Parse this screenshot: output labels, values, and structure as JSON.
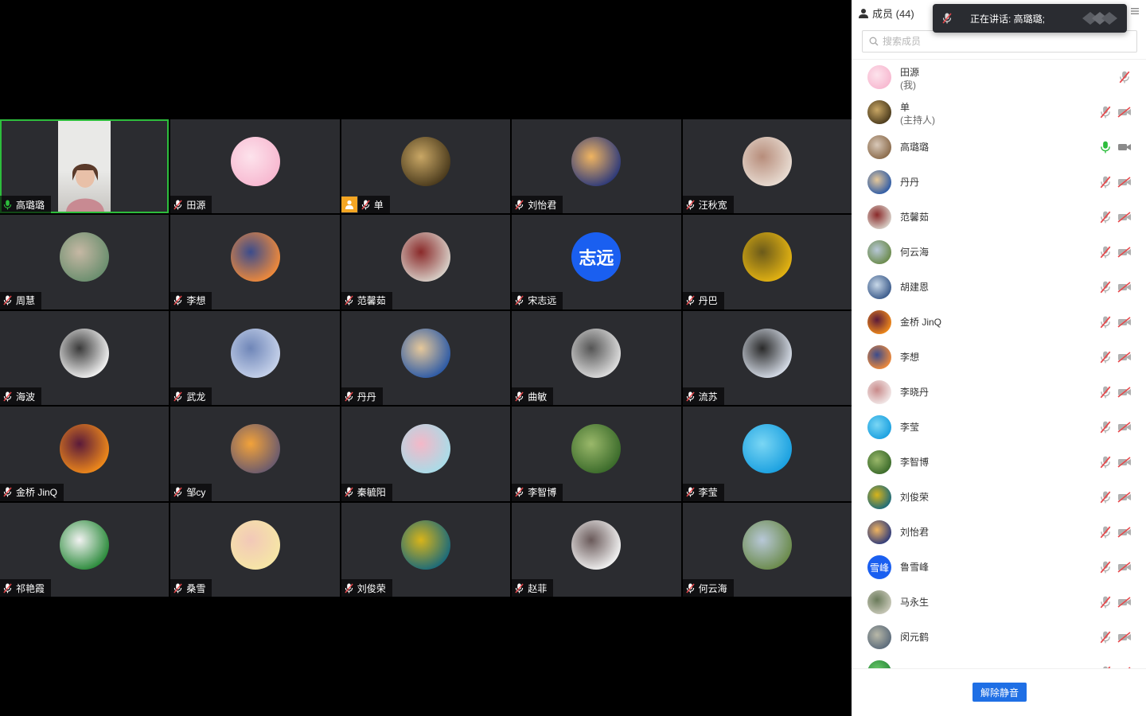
{
  "panel": {
    "title": "成员 (44)",
    "search_placeholder": "搜索成员",
    "unmute_all_label": "解除静音"
  },
  "toast": {
    "text": "正在讲话: 高璐璐;"
  },
  "tiles": [
    {
      "name": "高璐璐",
      "mic": "on",
      "video": true,
      "active": true,
      "colors": [
        "#e9e9e7",
        "#c8c6c2"
      ]
    },
    {
      "name": "田源",
      "mic": "muted",
      "colors": [
        "#f7b8d0",
        "#fde3ec"
      ]
    },
    {
      "name": "单",
      "mic": "muted",
      "host": true,
      "colors": [
        "#4a3a1c",
        "#c9a765"
      ]
    },
    {
      "name": "刘怡君",
      "mic": "muted",
      "colors": [
        "#2e3a7a",
        "#f0b460"
      ]
    },
    {
      "name": "汪秋宽",
      "mic": "muted",
      "colors": [
        "#e8dcd2",
        "#b78d7b"
      ]
    },
    {
      "name": "周慧",
      "mic": "muted",
      "colors": [
        "#6a8e6e",
        "#c6b8a4"
      ]
    },
    {
      "name": "李想",
      "mic": "muted",
      "colors": [
        "#f08a3a",
        "#3b4c8c"
      ]
    },
    {
      "name": "范馨茹",
      "mic": "muted",
      "colors": [
        "#d8d0c8",
        "#8a2a2a"
      ]
    },
    {
      "name": "宋志远",
      "mic": "muted",
      "text_avatar": "志远",
      "colors": [
        "#1a5ff0",
        "#1a5ff0"
      ]
    },
    {
      "name": "丹巴",
      "mic": "muted",
      "colors": [
        "#e3b312",
        "#6b5a1a"
      ]
    },
    {
      "name": "海波",
      "mic": "muted",
      "colors": [
        "#f2f2f2",
        "#3a3a3a"
      ]
    },
    {
      "name": "武龙",
      "mic": "muted",
      "colors": [
        "#c6d2ea",
        "#6f86b8"
      ]
    },
    {
      "name": "丹丹",
      "mic": "muted",
      "colors": [
        "#2c5aa6",
        "#e6c89a"
      ]
    },
    {
      "name": "曲敏",
      "mic": "muted",
      "colors": [
        "#dedede",
        "#555555"
      ]
    },
    {
      "name": "流苏",
      "mic": "muted",
      "colors": [
        "#d6dde8",
        "#2a2a2a"
      ]
    },
    {
      "name": "金桥 JinQ",
      "mic": "muted",
      "colors": [
        "#f08a1a",
        "#5a1a3a"
      ]
    },
    {
      "name": "邹cy",
      "mic": "muted",
      "colors": [
        "#6a5a6e",
        "#f2a23a"
      ]
    },
    {
      "name": "秦毓阳",
      "mic": "muted",
      "colors": [
        "#a8dce8",
        "#f4b8c8"
      ]
    },
    {
      "name": "李智博",
      "mic": "muted",
      "colors": [
        "#3a6a2a",
        "#9ab86a"
      ]
    },
    {
      "name": "李莹",
      "mic": "muted",
      "colors": [
        "#1aa0e0",
        "#7ad6f4"
      ]
    },
    {
      "name": "祁艳霞",
      "mic": "muted",
      "colors": [
        "#2a8a3a",
        "#f2f2f2"
      ]
    },
    {
      "name": "桑雪",
      "mic": "muted",
      "colors": [
        "#f6e6a6",
        "#f2c8b8"
      ]
    },
    {
      "name": "刘俊荣",
      "mic": "muted",
      "colors": [
        "#1a6a7a",
        "#d8b41a"
      ]
    },
    {
      "name": "赵菲",
      "mic": "muted",
      "colors": [
        "#f2f2f2",
        "#6a5a5a"
      ]
    },
    {
      "name": "何云海",
      "mic": "muted",
      "colors": [
        "#6a8a4a",
        "#b8c8d8"
      ]
    }
  ],
  "members": [
    {
      "name": "田源",
      "role": "(我)",
      "mic": "muted",
      "cam": "none",
      "colors": [
        "#f7b8d0",
        "#fde3ec"
      ]
    },
    {
      "name": "单",
      "role": "(主持人)",
      "mic": "muted",
      "cam": "off",
      "colors": [
        "#4a3a1c",
        "#c9a765"
      ]
    },
    {
      "name": "高璐璐",
      "mic": "on",
      "cam": "on",
      "colors": [
        "#8a6a4a",
        "#d8c8b8"
      ]
    },
    {
      "name": "丹丹",
      "mic": "muted",
      "cam": "off",
      "colors": [
        "#2c5aa6",
        "#e6c89a"
      ]
    },
    {
      "name": "范馨茹",
      "mic": "muted",
      "cam": "off",
      "colors": [
        "#d8d0c8",
        "#8a2a2a"
      ]
    },
    {
      "name": "何云海",
      "mic": "muted",
      "cam": "off",
      "colors": [
        "#6a8a4a",
        "#b8c8d8"
      ]
    },
    {
      "name": "胡建恩",
      "mic": "muted",
      "cam": "off",
      "colors": [
        "#3a5a8a",
        "#c8d8e8"
      ]
    },
    {
      "name": "金桥 JinQ",
      "mic": "muted",
      "cam": "off",
      "colors": [
        "#f08a1a",
        "#5a1a3a"
      ]
    },
    {
      "name": "李想",
      "mic": "muted",
      "cam": "off",
      "colors": [
        "#f08a3a",
        "#3b4c8c"
      ]
    },
    {
      "name": "李晓丹",
      "mic": "muted",
      "cam": "off",
      "colors": [
        "#f2e8e8",
        "#c88a8a"
      ]
    },
    {
      "name": "李莹",
      "mic": "muted",
      "cam": "off",
      "colors": [
        "#1aa0e0",
        "#7ad6f4"
      ]
    },
    {
      "name": "李智博",
      "mic": "muted",
      "cam": "off",
      "colors": [
        "#3a6a2a",
        "#9ab86a"
      ]
    },
    {
      "name": "刘俊荣",
      "mic": "muted",
      "cam": "off",
      "colors": [
        "#1a6a7a",
        "#d8b41a"
      ]
    },
    {
      "name": "刘怡君",
      "mic": "muted",
      "cam": "off",
      "colors": [
        "#2e3a7a",
        "#f0b460"
      ]
    },
    {
      "name": "鲁雪峰",
      "mic": "muted",
      "cam": "off",
      "text_avatar": "雪峰",
      "colors": [
        "#1a5ff0",
        "#1a5ff0"
      ]
    },
    {
      "name": "马永生",
      "mic": "muted",
      "cam": "off",
      "colors": [
        "#c8c8b8",
        "#6a7a5a"
      ]
    },
    {
      "name": "闵元鹤",
      "mic": "muted",
      "cam": "off",
      "colors": [
        "#5a6a7a",
        "#b8b8a8"
      ]
    },
    {
      "name": "",
      "mic": "muted",
      "cam": "off",
      "colors": [
        "#2a8a3a",
        "#6ac86a"
      ]
    }
  ]
}
